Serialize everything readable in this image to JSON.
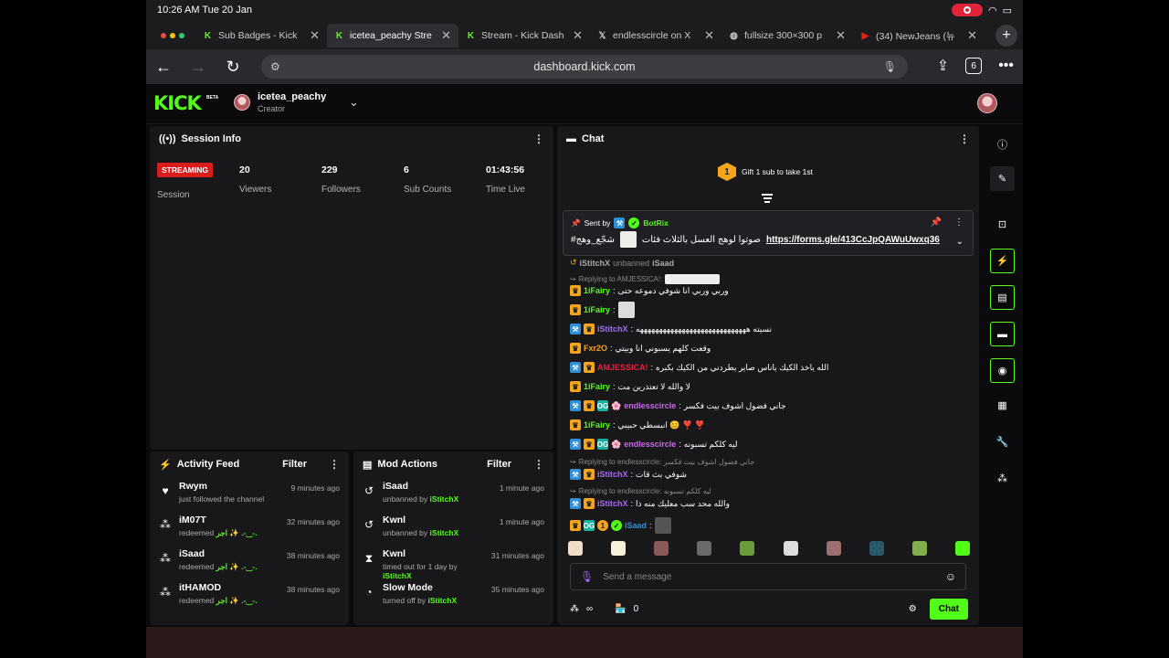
{
  "status": {
    "time": "10:26 AM  Tue 20 Jan"
  },
  "tabs": [
    {
      "title": "Sub Badges - Kick",
      "icon": "kick-icon",
      "active": false
    },
    {
      "title": "icetea_peachy Stre",
      "icon": "kick-icon",
      "active": true
    },
    {
      "title": "Stream - Kick Dash",
      "icon": "kick-icon",
      "active": false
    },
    {
      "title": "endlesscircle on X",
      "icon": "x-icon",
      "active": false
    },
    {
      "title": "fullsize 300×300 p",
      "icon": "globe-icon",
      "active": false
    },
    {
      "title": "(34) NewJeans (뉴",
      "icon": "youtube-icon",
      "active": false
    }
  ],
  "url": "dashboard.kick.com",
  "tab_count": "6",
  "header": {
    "logo": "KICK",
    "beta": "BETA",
    "channel": "icetea_peachy",
    "role": "Creator"
  },
  "session": {
    "title": "Session Info",
    "badge": "STREAMING",
    "label": "Session",
    "stats": [
      {
        "value": "20",
        "label": "Viewers"
      },
      {
        "value": "229",
        "label": "Followers"
      },
      {
        "value": "6",
        "label": "Sub Counts"
      },
      {
        "value": "01:43:56",
        "label": "Time Live"
      }
    ]
  },
  "activity": {
    "title": "Activity Feed",
    "filter": "Filter",
    "items": [
      {
        "name": "Rwym",
        "sub": "just followed the channel",
        "time": "9 minutes ago",
        "icon": "heart-icon"
      },
      {
        "name": "iM07T",
        "sub": "redeemed",
        "reward": "اجر ✨ .-‿-.",
        "time": "32 minutes ago",
        "icon": "points-icon"
      },
      {
        "name": "iSaad",
        "sub": "redeemed",
        "reward": "اجر ✨ .-‿-.",
        "time": "38 minutes ago",
        "icon": "points-icon"
      },
      {
        "name": "itHAMOD",
        "sub": "redeemed",
        "reward": "اجر ✨ .-‿-.",
        "time": "38 minutes ago",
        "icon": "points-icon"
      }
    ]
  },
  "mod": {
    "title": "Mod Actions",
    "filter": "Filter",
    "items": [
      {
        "name": "iSaad",
        "sub": "unbanned by",
        "by": "iStitchX",
        "time": "1 minute ago",
        "icon": "undo-icon"
      },
      {
        "name": "Kwnl",
        "sub": "unbanned by",
        "by": "iStitchX",
        "time": "1 minute ago",
        "icon": "undo-icon"
      },
      {
        "name": "Kwnl",
        "sub": "timed out for 1 day by",
        "by": "iStitchX",
        "time": "31 minutes ago",
        "icon": "hourglass-icon"
      },
      {
        "name": "Slow Mode",
        "sub": "turned off by",
        "by": "iStitchX",
        "time": "35 minutes ago",
        "icon": "slow-mode-icon"
      }
    ]
  },
  "chat": {
    "title": "Chat",
    "gift": "Gift 1 sub to take 1st",
    "gift_count": "1",
    "pinned": {
      "sent_by": "Sent by",
      "user": "BotRix",
      "text": "صوتوا لوهج العسل بالثلاث فئات",
      "link": "https://forms.gle/413CcJpQAWuUwxq36",
      "tag": "#شجّع_وهج"
    },
    "event": {
      "user": "iStitchX",
      "action": "unbanned",
      "target": "iSaad"
    },
    "messages": [
      {
        "reply": "Replying to AMJESSICA!:",
        "user": "1iFairy",
        "color": "#53fc18",
        "text": "وربي وربي انا شوفي دموعه حتى",
        "mod": false
      },
      {
        "user": "1iFairy",
        "color": "#53fc18",
        "text": "",
        "mod": false,
        "emote": true
      },
      {
        "user": "iStitchX",
        "color": "#a46af5",
        "text": "نسيته هههههههههههههههههههههههههههههه",
        "mod": true
      },
      {
        "user": "Fxr2O",
        "color": "#f4a51c",
        "text": "وقعت كلهم يسبوني انا وبيتي",
        "mod": false
      },
      {
        "user": "AMJESSICA!",
        "color": "#e8213b",
        "text": "الله ياخذ الكيك ياناس صاير يطردني من الكيك بكبره",
        "mod": true
      },
      {
        "user": "1iFairy",
        "color": "#53fc18",
        "text": "لا والله لا تعتذرين مت",
        "mod": false
      },
      {
        "user": "endlesscircle",
        "color": "#c96ae6",
        "text": "جاني فضول اشوف بيت فكسر",
        "mod": true,
        "og": true
      },
      {
        "user": "1iFairy",
        "color": "#53fc18",
        "text": "انبسطي حبيبي 😊 ❣️ ❣️",
        "mod": false
      },
      {
        "user": "endlesscircle",
        "color": "#c96ae6",
        "text": "ليه كلكم تسبونه",
        "mod": true,
        "og": true
      },
      {
        "reply": "Replying to endlesscircle: جاني فضول اشوف بيت فكسر",
        "user": "iStitchX",
        "color": "#a46af5",
        "text": "شوفي بث قات",
        "mod": true
      },
      {
        "reply": "Replying to endlesscircle: ليه كلكم تسبونه",
        "user": "iStitchX",
        "color": "#a46af5",
        "text": "والله محد سب معليك منه ذا",
        "mod": true
      },
      {
        "user": "iSaad",
        "color": "#2f8fd8",
        "text": "",
        "mod": false,
        "og": true,
        "emote": true
      }
    ],
    "placeholder": "Send a message",
    "points": "∞",
    "store_count": "0",
    "send": "Chat"
  },
  "colors": {
    "kick_green": "#53fc18",
    "live_red": "#d91d1d",
    "panel_bg": "#18181b"
  }
}
